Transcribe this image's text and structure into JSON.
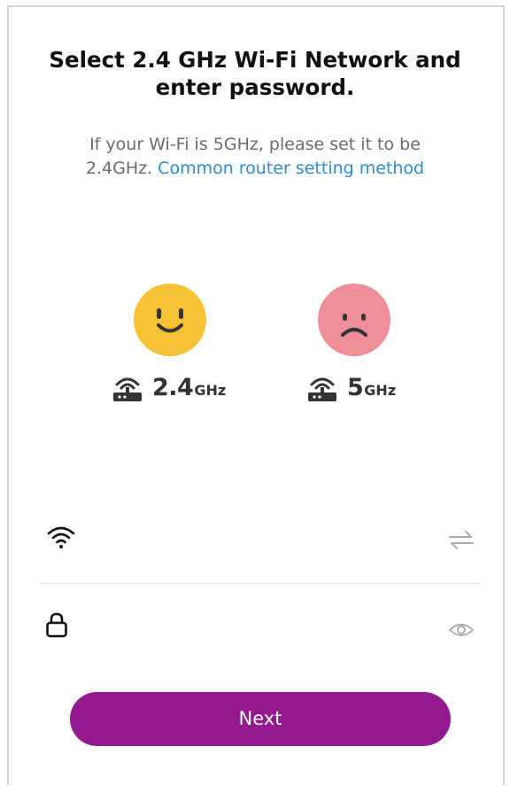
{
  "header": {
    "title_line1": "Select 2.4 GHz Wi-Fi Network and",
    "title_line2": "enter password."
  },
  "hint": {
    "text_line1": "If your Wi-Fi is 5GHz, please set it to be",
    "text_line2": "2.4GHz.",
    "link_label": "Common router setting method"
  },
  "bands": [
    {
      "number": "2.4",
      "unit": "GHz",
      "face": "smile-face-icon",
      "color": "#f6c034"
    },
    {
      "number": "5",
      "unit": "GHz",
      "face": "sad-face-icon",
      "color": "#ef8e98"
    }
  ],
  "form": {
    "ssid_value": "",
    "password_value": ""
  },
  "actions": {
    "next_label": "Next"
  },
  "colors": {
    "accent": "#93198f",
    "link": "#2f8ad6"
  }
}
